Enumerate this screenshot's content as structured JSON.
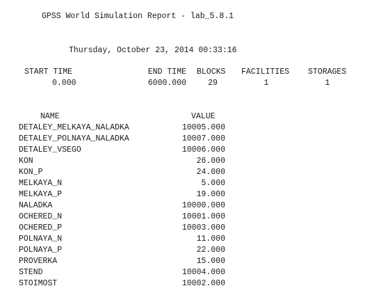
{
  "report": {
    "title": "GPSS World Simulation Report - lab_5.8.1",
    "date": "Thursday, October 23, 2014 00:33:16",
    "summary": {
      "headers": {
        "start_time": "START TIME",
        "end_time": "END TIME",
        "blocks": "BLOCKS",
        "facilities": "FACILITIES",
        "storages": "STORAGES"
      },
      "values": {
        "start_time": "0.000",
        "end_time": "6000.000",
        "blocks": "29",
        "facilities": "1",
        "storages": "1"
      }
    },
    "table": {
      "headers": {
        "name": "NAME",
        "value": "VALUE"
      },
      "rows": [
        {
          "name": "DETALEY_MELKAYA_NALADKA",
          "value": "10005.000"
        },
        {
          "name": "DETALEY_POLNAYA_NALADKA",
          "value": "10007.000"
        },
        {
          "name": "DETALEY_VSEGO",
          "value": "10006.000"
        },
        {
          "name": "KON",
          "value": "26.000"
        },
        {
          "name": "KON_P",
          "value": "24.000"
        },
        {
          "name": "MELKAYA_N",
          "value": "5.000"
        },
        {
          "name": "MELKAYA_P",
          "value": "19.000"
        },
        {
          "name": "NALADKA",
          "value": "10000.000"
        },
        {
          "name": "OCHERED_N",
          "value": "10001.000"
        },
        {
          "name": "OCHERED_P",
          "value": "10003.000"
        },
        {
          "name": "POLNAYA_N",
          "value": "11.000"
        },
        {
          "name": "POLNAYA_P",
          "value": "22.000"
        },
        {
          "name": "PROVERKA",
          "value": "15.000"
        },
        {
          "name": "STEND",
          "value": "10004.000"
        },
        {
          "name": "STOIMOST",
          "value": "10002.000"
        }
      ]
    }
  }
}
